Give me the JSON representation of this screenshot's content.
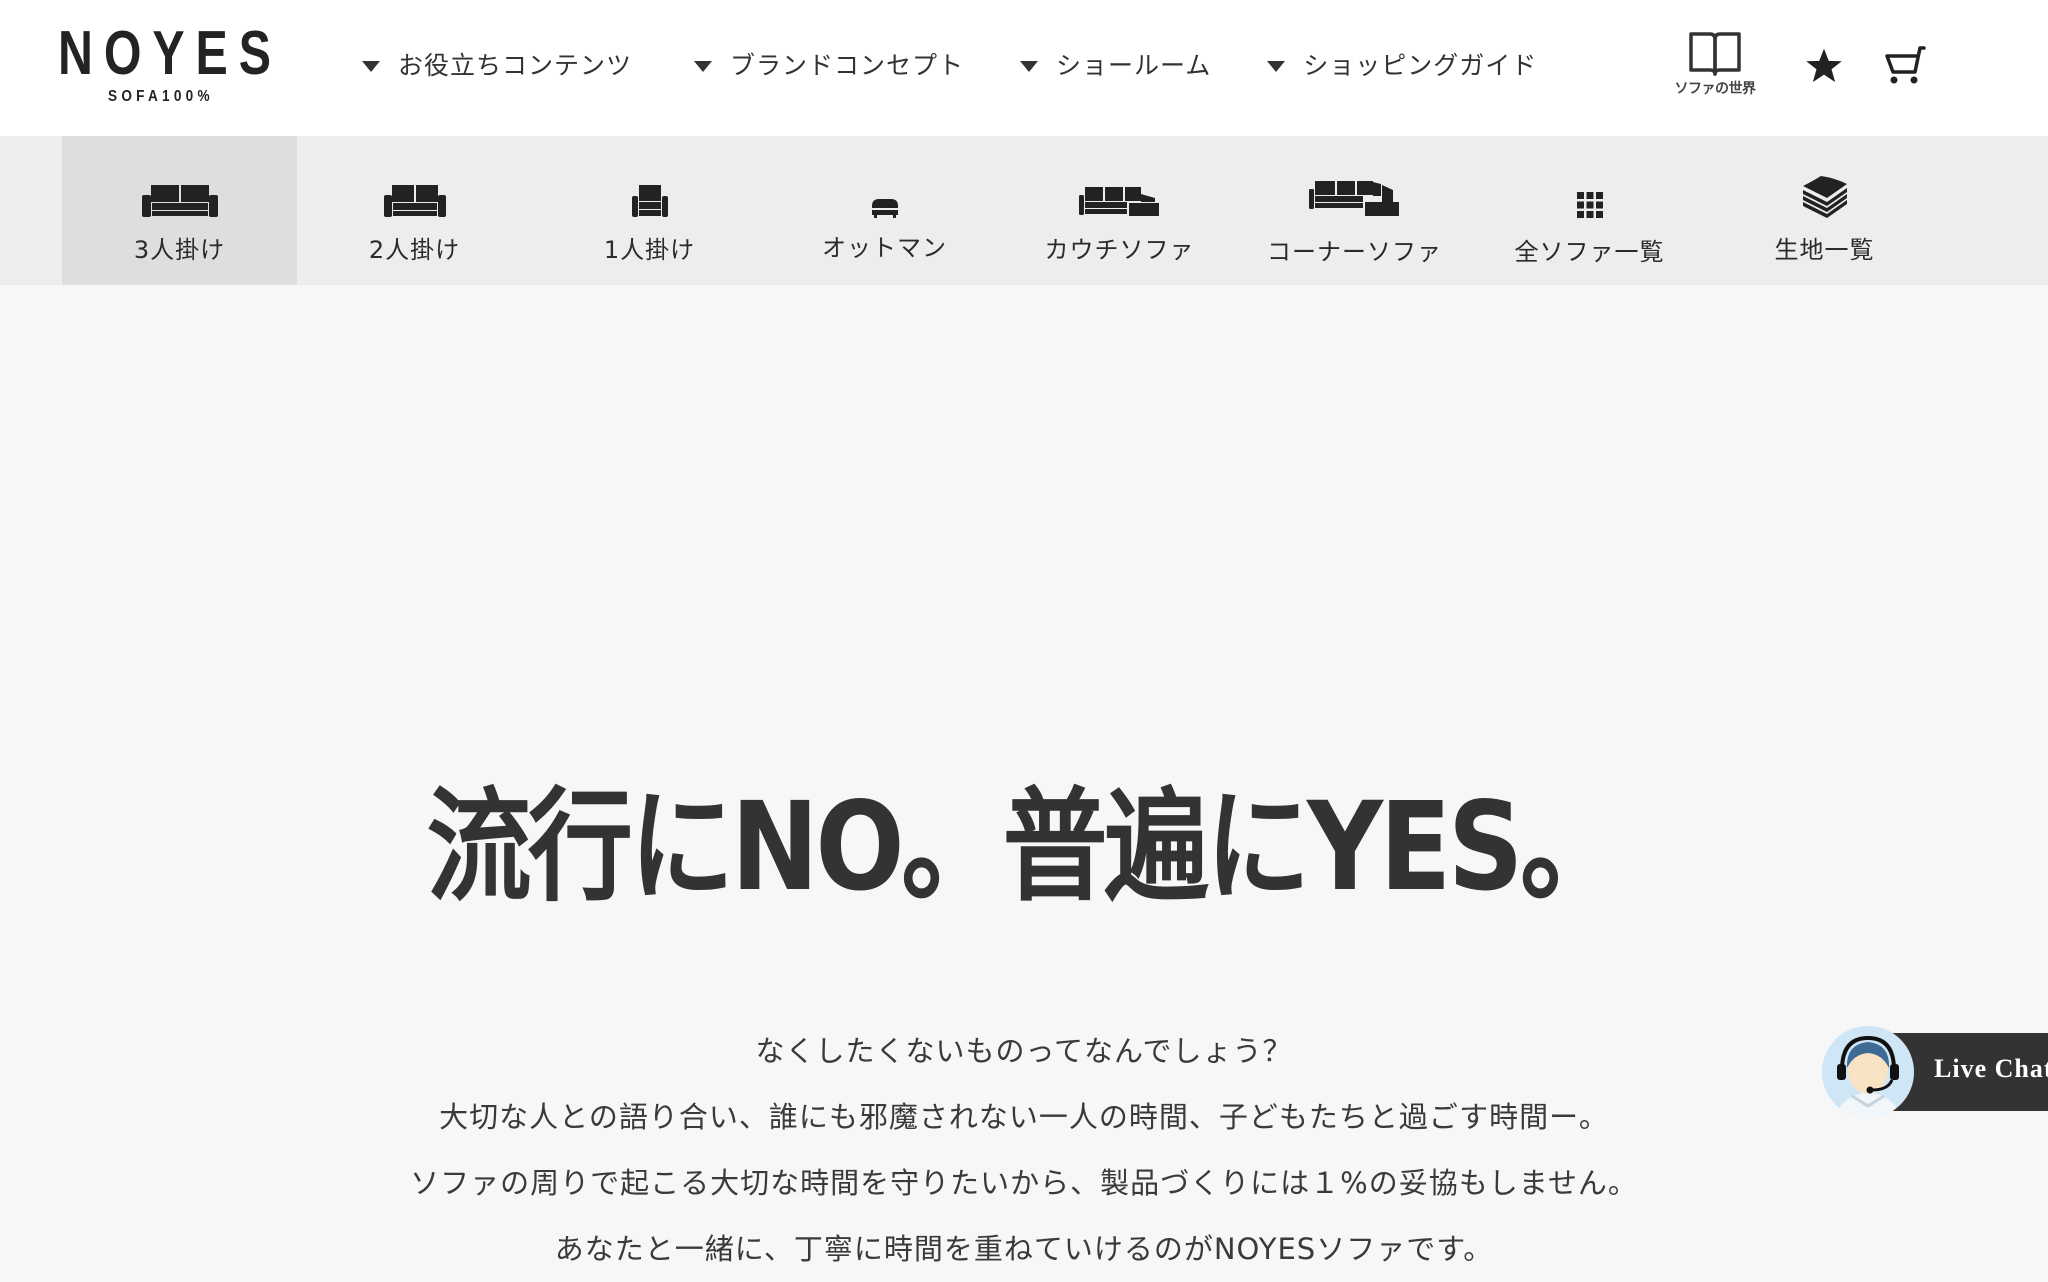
{
  "header": {
    "logo": {
      "main": "NOYES",
      "sub": "SOFA100%"
    },
    "nav": [
      {
        "label": "お役立ちコンテンツ",
        "icon": "caret-down-icon"
      },
      {
        "label": "ブランドコンセプト",
        "icon": "caret-down-icon"
      },
      {
        "label": "ショールーム",
        "icon": "caret-down-icon"
      },
      {
        "label": "ショッピングガイド",
        "icon": "caret-down-icon"
      }
    ],
    "tools": {
      "world": {
        "label": "ソファの世界",
        "icon": "open-book-icon"
      },
      "favorites": {
        "icon": "star-icon"
      },
      "cart": {
        "icon": "cart-icon"
      }
    }
  },
  "categories": [
    {
      "label": "3人掛け",
      "icon": "three-seat-sofa-icon",
      "active": true
    },
    {
      "label": "2人掛け",
      "icon": "two-seat-sofa-icon",
      "active": false
    },
    {
      "label": "1人掛け",
      "icon": "armchair-icon",
      "active": false
    },
    {
      "label": "オットマン",
      "icon": "ottoman-icon",
      "active": false
    },
    {
      "label": "カウチソファ",
      "icon": "couch-sofa-icon",
      "active": false
    },
    {
      "label": "コーナーソファ",
      "icon": "corner-sofa-icon",
      "active": false
    },
    {
      "label": "全ソファ一覧",
      "icon": "grid-icon",
      "active": false
    },
    {
      "label": "生地一覧",
      "icon": "fabric-stack-icon",
      "active": false
    }
  ],
  "hero": {
    "title": "流行にNO。普遍にYES。",
    "lines": [
      "なくしたくないものってなんでしょう？",
      "大切な人との語り合い、誰にも邪魔されない一人の時間、子どもたちと過ごす時間ー。",
      "ソファの周りで起こる大切な時間を守りたいから、製品づくりには１%の妥協もしません。",
      "あなたと一緒に、丁寧に時間を重ねていけるのがNOYESソファです。"
    ]
  },
  "live_chat": {
    "label": "Live Chat",
    "icon": "support-agent-avatar-icon"
  },
  "colors": {
    "header_bg": "#ffffff",
    "catbar_bg": "#ededed",
    "catbar_active_bg": "#dedede",
    "page_bg": "#f7f7f7",
    "text": "#333333",
    "chat_bg": "#333333"
  }
}
